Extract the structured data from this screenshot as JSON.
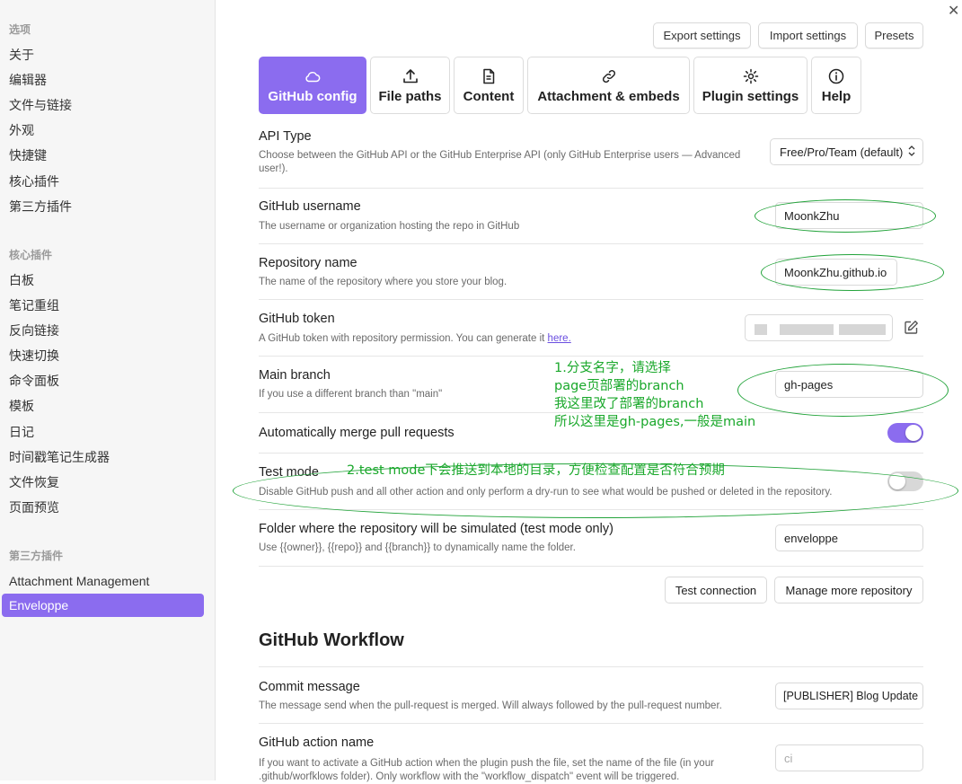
{
  "sidebar": {
    "group_options": "选项",
    "options": [
      "关于",
      "编辑器",
      "文件与链接",
      "外观",
      "快捷键",
      "核心插件",
      "第三方插件"
    ],
    "group_core": "核心插件",
    "core": [
      "白板",
      "笔记重组",
      "反向链接",
      "快速切换",
      "命令面板",
      "模板",
      "日记",
      "时间戳笔记生成器",
      "文件恢复",
      "页面预览"
    ],
    "group_third": "第三方插件",
    "third": [
      "Attachment Management",
      "Enveloppe"
    ]
  },
  "header": {
    "close": "✕",
    "export": "Export settings",
    "import": "Import settings",
    "presets": "Presets"
  },
  "tabs": [
    {
      "label": "GitHub config",
      "icon": "cloud-icon"
    },
    {
      "label": "File paths",
      "icon": "upload-icon"
    },
    {
      "label": "Content",
      "icon": "document-icon"
    },
    {
      "label": "Attachment & embeds",
      "icon": "link-icon"
    },
    {
      "label": "Plugin settings",
      "icon": "gear-icon"
    },
    {
      "label": "Help",
      "icon": "info-icon"
    }
  ],
  "settings": {
    "api_type": {
      "name": "API Type",
      "desc": "Choose between the GitHub API or the GitHub Enterprise API (only GitHub Enterprise users — Advanced user!).",
      "value": "Free/Pro/Team (default)"
    },
    "username": {
      "name": "GitHub username",
      "desc": "The username or organization hosting the repo in GitHub",
      "value": "MoonkZhu"
    },
    "repo": {
      "name": "Repository name",
      "desc": "The name of the repository where you store your blog.",
      "value": "MoonkZhu.github.io"
    },
    "token": {
      "name": "GitHub token",
      "desc": "A GitHub token with repository permission. You can generate it ",
      "link": "here."
    },
    "branch": {
      "name": "Main branch",
      "desc": "If you use a different branch than \"main\"",
      "value": "gh-pages"
    },
    "automerge": {
      "name": "Automatically merge pull requests",
      "on": true
    },
    "testmode": {
      "name": "Test mode",
      "desc": "Disable GitHub push and all other action and only perform a dry-run to see what would be pushed or deleted in the repository.",
      "on": false
    },
    "folder": {
      "name": "Folder where the repository will be simulated (test mode only)",
      "desc": "Use {{owner}}, {{repo}} and {{branch}} to dynamically name the folder.",
      "value": "enveloppe"
    }
  },
  "actions": {
    "test": "Test connection",
    "manage": "Manage more repository"
  },
  "workflow": {
    "title": "GitHub Workflow",
    "commit": {
      "name": "Commit message",
      "desc": "The message send when the pull-request is merged. Will always followed by the pull-request number.",
      "value": "[PUBLISHER] Blog Update"
    },
    "action": {
      "name": "GitHub action name",
      "desc1": "If you want to activate a GitHub action when the plugin push the file, set the name of the file (in your",
      "desc2": ".github/worfklows folder). Only workflow with the \"workflow_dispatch\" event will be triggered.",
      "placeholder": "ci"
    }
  },
  "annotations": {
    "branch_note": [
      "1.分支名字，请选择",
      "page页部署的branch",
      "我这里改了部署的branch",
      "所以这里是gh-pages,一般是main"
    ],
    "test_note": "2.test mode下会推送到本地的目录，方便检查配置是否符合预期"
  },
  "colors": {
    "accent": "#8b6cef",
    "annotation": "#1aa82b"
  }
}
